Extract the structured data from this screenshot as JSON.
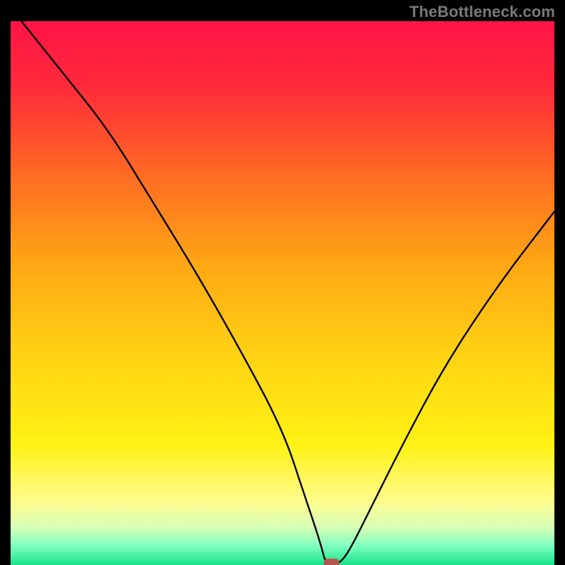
{
  "watermark": "TheBottleneck.com",
  "colors": {
    "frame": "#000000",
    "gradient_stops": [
      {
        "offset": 0.0,
        "color": "#ff1446"
      },
      {
        "offset": 0.12,
        "color": "#ff2a3a"
      },
      {
        "offset": 0.28,
        "color": "#ff6a23"
      },
      {
        "offset": 0.45,
        "color": "#ffa814"
      },
      {
        "offset": 0.62,
        "color": "#ffd413"
      },
      {
        "offset": 0.78,
        "color": "#fff215"
      },
      {
        "offset": 0.88,
        "color": "#fffb8a"
      },
      {
        "offset": 0.93,
        "color": "#d9ffb6"
      },
      {
        "offset": 0.965,
        "color": "#7fffc0"
      },
      {
        "offset": 1.0,
        "color": "#18e38a"
      }
    ],
    "curve": "#000000",
    "marker": "#b85450"
  },
  "chart_data": {
    "type": "line",
    "title": "",
    "xlabel": "",
    "ylabel": "",
    "xlim": [
      0,
      100
    ],
    "ylim": [
      0,
      100
    ],
    "x": [
      2,
      10,
      18,
      26,
      34,
      42,
      50,
      54,
      57,
      58,
      60,
      62,
      66,
      72,
      80,
      90,
      100
    ],
    "values": [
      100,
      90,
      80,
      67,
      54,
      40,
      25,
      13,
      4,
      0,
      0,
      2,
      10,
      22,
      37,
      52,
      65
    ],
    "marker": {
      "x": 59,
      "y": 0
    },
    "notes": "V-shaped bottleneck curve; minimum (optimal balance) near x≈59 where value≈0. Values are approximate, read from the plotted curve against the 0–100 frame."
  }
}
